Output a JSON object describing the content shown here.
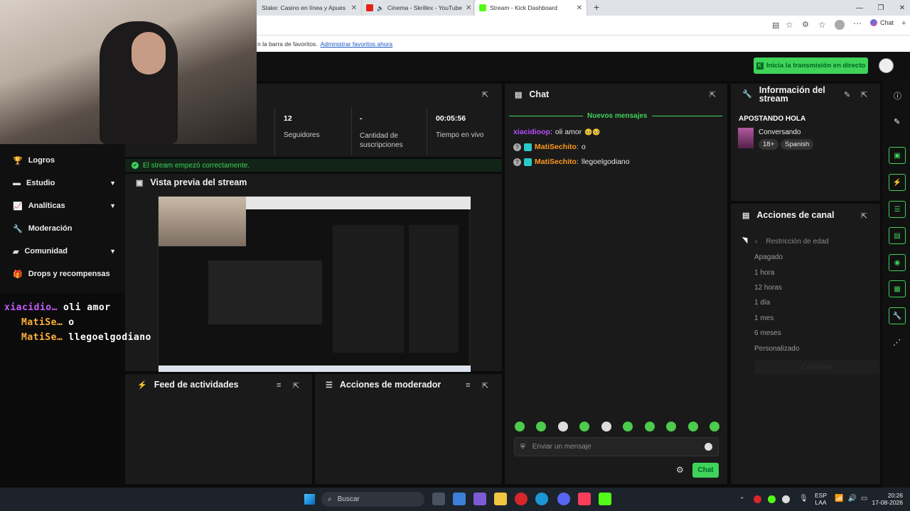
{
  "browser": {
    "tabs": [
      {
        "label": "Stake: Casino en línea y Apuestas D",
        "color": "#1c2c3a"
      },
      {
        "label": "Cinema - Skrillex - YouTube",
        "color": "#e62117"
      },
      {
        "label": "Stream - Kick Dashboard",
        "color": "#53fc18"
      }
    ],
    "new_tab_icon": "plus-icon",
    "favbar_text": "n la barra de favoritos.",
    "favbar_link": "Administrar favoritos ahora",
    "copilot_label": "Chat"
  },
  "header": {
    "go_live_label": "Inicia la transmisión en directo",
    "accent": "#3fd35a"
  },
  "sidebar": {
    "items": [
      {
        "label": "Logros",
        "icon": "trophy-icon",
        "expandable": false
      },
      {
        "label": "Estudio",
        "icon": "studio-icon",
        "expandable": true
      },
      {
        "label": "Analíticas",
        "icon": "chart-icon",
        "expandable": true
      },
      {
        "label": "Moderación",
        "icon": "wrench-icon",
        "expandable": false
      },
      {
        "label": "Comunidad",
        "icon": "community-icon",
        "expandable": true
      },
      {
        "label": "Drops y recompensas",
        "icon": "gift-icon",
        "expandable": false
      }
    ]
  },
  "stats": [
    {
      "value": "12",
      "label": "Seguidores"
    },
    {
      "value": "-",
      "label": "Cantidad de suscripciones"
    },
    {
      "value": "00:05:56",
      "label": "Tiempo en vivo"
    }
  ],
  "status_message": "El stream empezó correctamente.",
  "preview": {
    "title": "Vista previa del stream"
  },
  "activity_feed": {
    "title": "Feed de actividades"
  },
  "mod_actions": {
    "title": "Acciones de moderador"
  },
  "chat": {
    "title": "Chat",
    "new_messages_label": "Nuevos mensajes",
    "messages": [
      {
        "user": "xiacidioop",
        "text": "oli amor",
        "user_color": "#b84dff"
      },
      {
        "user": "MatiSechito",
        "text": "o",
        "user_color": "#ff9a1f"
      },
      {
        "user": "MatiSechito",
        "text": "llegoelgodiano",
        "user_color": "#ff9a1f"
      }
    ],
    "input_placeholder": "Enviar un mensaje",
    "send_label": "Chat"
  },
  "stream_info": {
    "title": "Información del stream",
    "stream_title": "APOSTANDO HOLA",
    "category": "Conversando",
    "tags": [
      "18+",
      "Spanish"
    ]
  },
  "channel_actions": {
    "title": "Acciones de canal",
    "submenu_title": "Restricción de edad",
    "options": [
      "Apagado",
      "1 hora",
      "12 horas",
      "1 día",
      "1 mes",
      "6 meses",
      "Personalizado"
    ],
    "confirm_label": "Confirmar"
  },
  "overlay_chat": [
    {
      "user": "xiacidio…",
      "text": "oli amor",
      "user_color": "#c85cff"
    },
    {
      "user": "MatiSe…",
      "text": "o",
      "user_color": "#ffb13b"
    },
    {
      "user": "MatiSe…",
      "text": "llegoelgodiano",
      "user_color": "#ffb13b"
    }
  ],
  "taskbar": {
    "search_placeholder": "Buscar",
    "lang_top": "ESP",
    "lang_bottom": "LAA",
    "time": "20:26",
    "date": "17-08-2026"
  }
}
